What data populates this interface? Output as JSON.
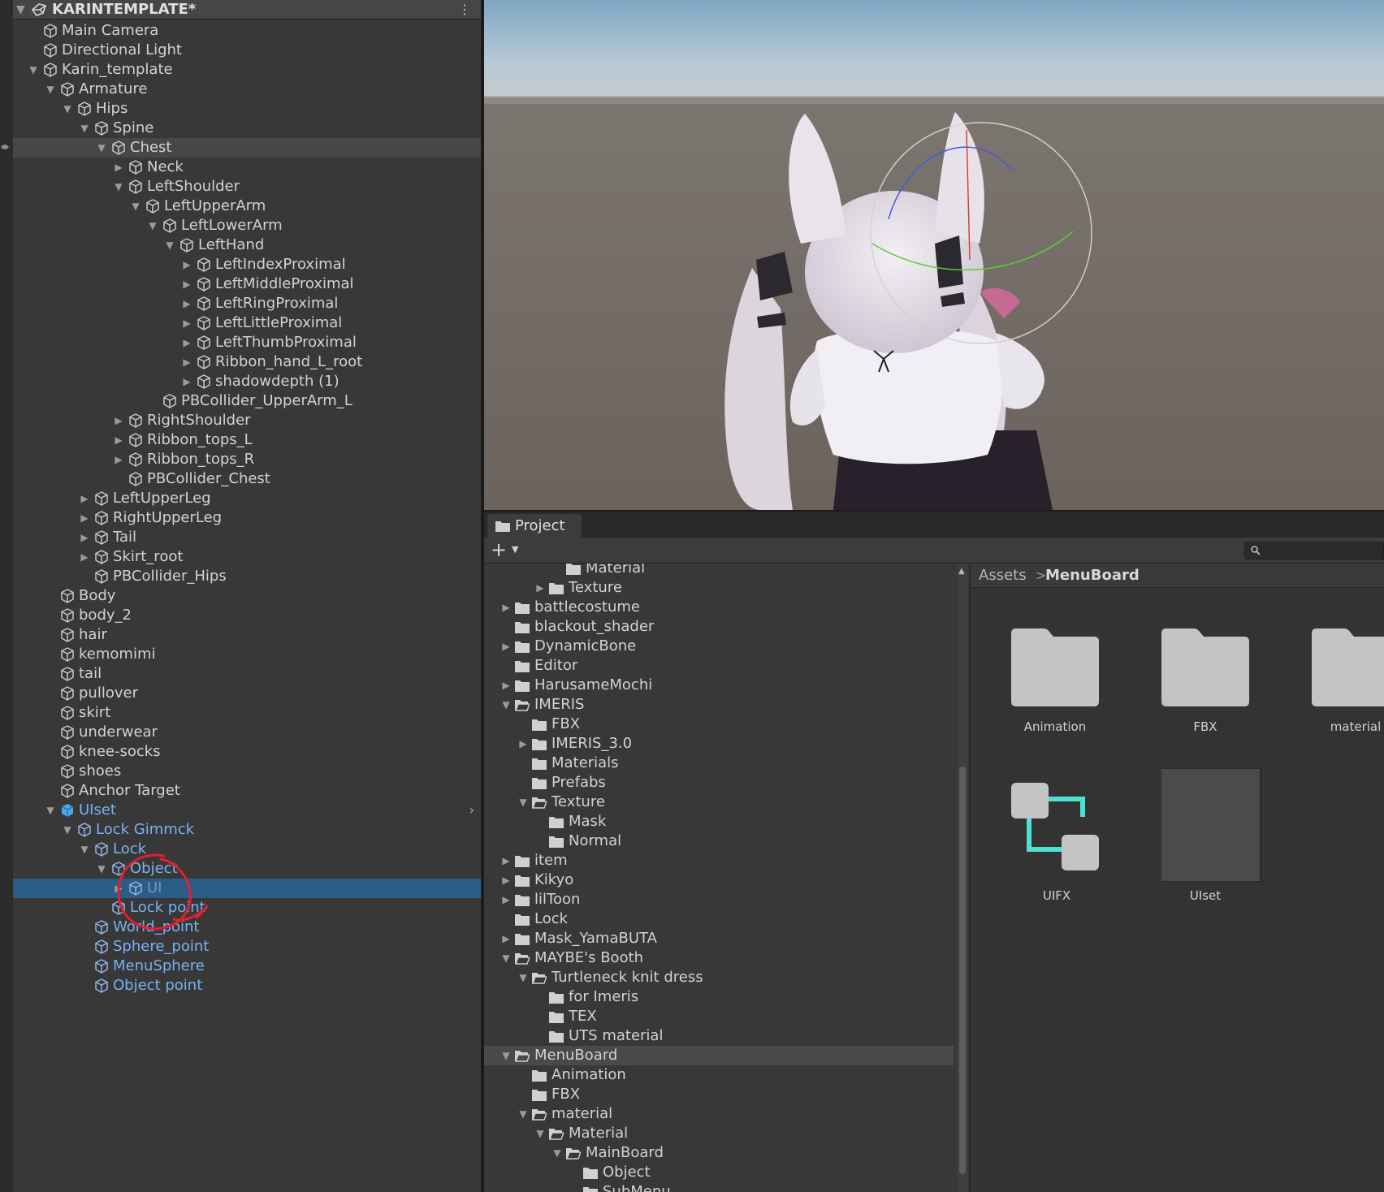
{
  "hierarchy": {
    "scene_title": "KARINTEMPLATE*",
    "rows": [
      {
        "label": "Main Camera",
        "depth": 2,
        "arrow": "",
        "icon": "cube-icon",
        "state": ""
      },
      {
        "label": "Directional Light",
        "depth": 2,
        "arrow": "",
        "icon": "cube-icon",
        "state": ""
      },
      {
        "label": "Karin_template",
        "depth": 2,
        "arrow": "down",
        "icon": "cube-icon",
        "state": ""
      },
      {
        "label": "Armature",
        "depth": 3,
        "arrow": "down",
        "icon": "cube-icon",
        "state": ""
      },
      {
        "label": "Hips",
        "depth": 4,
        "arrow": "down",
        "icon": "cube-icon",
        "state": ""
      },
      {
        "label": "Spine",
        "depth": 5,
        "arrow": "down",
        "icon": "cube-icon",
        "state": ""
      },
      {
        "label": "Chest",
        "depth": 6,
        "arrow": "down",
        "icon": "cube-icon",
        "state": "hover"
      },
      {
        "label": "Neck",
        "depth": 7,
        "arrow": "right",
        "icon": "cube-icon",
        "state": ""
      },
      {
        "label": "LeftShoulder",
        "depth": 7,
        "arrow": "down",
        "icon": "cube-icon",
        "state": ""
      },
      {
        "label": "LeftUpperArm",
        "depth": 8,
        "arrow": "down",
        "icon": "cube-icon",
        "state": ""
      },
      {
        "label": "LeftLowerArm",
        "depth": 9,
        "arrow": "down",
        "icon": "cube-icon",
        "state": ""
      },
      {
        "label": "LeftHand",
        "depth": 10,
        "arrow": "down",
        "icon": "cube-icon",
        "state": ""
      },
      {
        "label": "LeftIndexProximal",
        "depth": 11,
        "arrow": "right",
        "icon": "cube-icon",
        "state": ""
      },
      {
        "label": "LeftMiddleProximal",
        "depth": 11,
        "arrow": "right",
        "icon": "cube-icon",
        "state": ""
      },
      {
        "label": "LeftRingProximal",
        "depth": 11,
        "arrow": "right",
        "icon": "cube-icon",
        "state": ""
      },
      {
        "label": "LeftLittleProximal",
        "depth": 11,
        "arrow": "right",
        "icon": "cube-icon",
        "state": ""
      },
      {
        "label": "LeftThumbProximal",
        "depth": 11,
        "arrow": "right",
        "icon": "cube-icon",
        "state": ""
      },
      {
        "label": "Ribbon_hand_L_root",
        "depth": 11,
        "arrow": "right",
        "icon": "cube-icon",
        "state": ""
      },
      {
        "label": "shadowdepth (1)",
        "depth": 11,
        "arrow": "right",
        "icon": "cube-icon",
        "state": ""
      },
      {
        "label": "PBCollider_UpperArm_L",
        "depth": 9,
        "arrow": "",
        "icon": "cube-icon",
        "state": ""
      },
      {
        "label": "RightShoulder",
        "depth": 7,
        "arrow": "right",
        "icon": "cube-icon",
        "state": ""
      },
      {
        "label": "Ribbon_tops_L",
        "depth": 7,
        "arrow": "right",
        "icon": "cube-icon",
        "state": ""
      },
      {
        "label": "Ribbon_tops_R",
        "depth": 7,
        "arrow": "right",
        "icon": "cube-icon",
        "state": ""
      },
      {
        "label": "PBCollider_Chest",
        "depth": 7,
        "arrow": "",
        "icon": "cube-icon",
        "state": ""
      },
      {
        "label": "LeftUpperLeg",
        "depth": 5,
        "arrow": "right",
        "icon": "cube-icon",
        "state": ""
      },
      {
        "label": "RightUpperLeg",
        "depth": 5,
        "arrow": "right",
        "icon": "cube-icon",
        "state": ""
      },
      {
        "label": "Tail",
        "depth": 5,
        "arrow": "right",
        "icon": "cube-icon",
        "state": ""
      },
      {
        "label": "Skirt_root",
        "depth": 5,
        "arrow": "right",
        "icon": "cube-icon",
        "state": ""
      },
      {
        "label": "PBCollider_Hips",
        "depth": 5,
        "arrow": "",
        "icon": "cube-icon",
        "state": ""
      },
      {
        "label": "Body",
        "depth": 3,
        "arrow": "",
        "icon": "cube-icon",
        "state": ""
      },
      {
        "label": "body_2",
        "depth": 3,
        "arrow": "",
        "icon": "cube-icon",
        "state": ""
      },
      {
        "label": "hair",
        "depth": 3,
        "arrow": "",
        "icon": "cube-icon",
        "state": ""
      },
      {
        "label": "kemomimi",
        "depth": 3,
        "arrow": "",
        "icon": "cube-icon",
        "state": ""
      },
      {
        "label": "tail",
        "depth": 3,
        "arrow": "",
        "icon": "cube-icon",
        "state": ""
      },
      {
        "label": "pullover",
        "depth": 3,
        "arrow": "",
        "icon": "cube-icon",
        "state": ""
      },
      {
        "label": "skirt",
        "depth": 3,
        "arrow": "",
        "icon": "cube-icon",
        "state": ""
      },
      {
        "label": "underwear",
        "depth": 3,
        "arrow": "",
        "icon": "cube-icon",
        "state": ""
      },
      {
        "label": "knee-socks",
        "depth": 3,
        "arrow": "",
        "icon": "cube-icon",
        "state": ""
      },
      {
        "label": "shoes",
        "depth": 3,
        "arrow": "",
        "icon": "cube-icon",
        "state": ""
      },
      {
        "label": "Anchor Target",
        "depth": 3,
        "arrow": "",
        "icon": "cube-icon",
        "state": ""
      },
      {
        "label": "UIset",
        "depth": 3,
        "arrow": "down",
        "icon": "prefab-icon",
        "state": "blue",
        "chevron": true
      },
      {
        "label": "Lock Gimmck",
        "depth": 4,
        "arrow": "down",
        "icon": "cube-icon",
        "state": "blue"
      },
      {
        "label": "Lock",
        "depth": 5,
        "arrow": "down",
        "icon": "cube-icon",
        "state": "blue"
      },
      {
        "label": "Object",
        "depth": 6,
        "arrow": "down",
        "icon": "cube-icon",
        "state": "blue"
      },
      {
        "label": "UI",
        "depth": 7,
        "arrow": "right",
        "icon": "cube-icon",
        "state": "selected"
      },
      {
        "label": "Lock point",
        "depth": 6,
        "arrow": "",
        "icon": "cube-icon",
        "state": "blue"
      },
      {
        "label": "World_point",
        "depth": 5,
        "arrow": "",
        "icon": "cube-icon",
        "state": "blue"
      },
      {
        "label": "Sphere_point",
        "depth": 5,
        "arrow": "",
        "icon": "cube-icon",
        "state": "blue"
      },
      {
        "label": "MenuSphere",
        "depth": 5,
        "arrow": "",
        "icon": "cube-icon",
        "state": "blue"
      },
      {
        "label": "Object point",
        "depth": 5,
        "arrow": "",
        "icon": "cube-icon",
        "state": "blue"
      }
    ]
  },
  "project": {
    "tab_label": "Project",
    "add_label": "+",
    "search_placeholder": "",
    "tree": [
      {
        "label": "Material",
        "depth": 4,
        "arrow": "",
        "open": false,
        "state": ""
      },
      {
        "label": "Texture",
        "depth": 3,
        "arrow": "right",
        "open": false,
        "state": ""
      },
      {
        "label": "battlecostume",
        "depth": 1,
        "arrow": "right",
        "open": false,
        "state": ""
      },
      {
        "label": "blackout_shader",
        "depth": 1,
        "arrow": "",
        "open": false,
        "state": ""
      },
      {
        "label": "DynamicBone",
        "depth": 1,
        "arrow": "right",
        "open": false,
        "state": ""
      },
      {
        "label": "Editor",
        "depth": 1,
        "arrow": "",
        "open": false,
        "state": ""
      },
      {
        "label": "HarusameMochi",
        "depth": 1,
        "arrow": "right",
        "open": false,
        "state": ""
      },
      {
        "label": "IMERIS",
        "depth": 1,
        "arrow": "down",
        "open": true,
        "state": ""
      },
      {
        "label": "FBX",
        "depth": 2,
        "arrow": "",
        "open": false,
        "state": ""
      },
      {
        "label": "IMERIS_3.0",
        "depth": 2,
        "arrow": "right",
        "open": false,
        "state": ""
      },
      {
        "label": "Materials",
        "depth": 2,
        "arrow": "",
        "open": false,
        "state": ""
      },
      {
        "label": "Prefabs",
        "depth": 2,
        "arrow": "",
        "open": false,
        "state": ""
      },
      {
        "label": "Texture",
        "depth": 2,
        "arrow": "down",
        "open": true,
        "state": ""
      },
      {
        "label": "Mask",
        "depth": 3,
        "arrow": "",
        "open": false,
        "state": ""
      },
      {
        "label": "Normal",
        "depth": 3,
        "arrow": "",
        "open": false,
        "state": ""
      },
      {
        "label": "item",
        "depth": 1,
        "arrow": "right",
        "open": false,
        "state": ""
      },
      {
        "label": "Kikyo",
        "depth": 1,
        "arrow": "right",
        "open": false,
        "state": ""
      },
      {
        "label": "lilToon",
        "depth": 1,
        "arrow": "right",
        "open": false,
        "state": ""
      },
      {
        "label": "Lock",
        "depth": 1,
        "arrow": "",
        "open": false,
        "state": ""
      },
      {
        "label": "Mask_YamaBUTA",
        "depth": 1,
        "arrow": "right",
        "open": false,
        "state": ""
      },
      {
        "label": "MAYBE's Booth",
        "depth": 1,
        "arrow": "down",
        "open": true,
        "state": ""
      },
      {
        "label": "Turtleneck knit dress",
        "depth": 2,
        "arrow": "down",
        "open": true,
        "state": ""
      },
      {
        "label": "for Imeris",
        "depth": 3,
        "arrow": "",
        "open": false,
        "state": ""
      },
      {
        "label": "TEX",
        "depth": 3,
        "arrow": "",
        "open": false,
        "state": ""
      },
      {
        "label": "UTS material",
        "depth": 3,
        "arrow": "",
        "open": false,
        "state": ""
      },
      {
        "label": "MenuBoard",
        "depth": 1,
        "arrow": "down",
        "open": true,
        "state": "hover"
      },
      {
        "label": "Animation",
        "depth": 2,
        "arrow": "",
        "open": false,
        "state": ""
      },
      {
        "label": "FBX",
        "depth": 2,
        "arrow": "",
        "open": false,
        "state": ""
      },
      {
        "label": "material",
        "depth": 2,
        "arrow": "down",
        "open": true,
        "state": ""
      },
      {
        "label": "Material",
        "depth": 3,
        "arrow": "down",
        "open": true,
        "state": ""
      },
      {
        "label": "MainBoard",
        "depth": 4,
        "arrow": "down",
        "open": true,
        "state": ""
      },
      {
        "label": "Object",
        "depth": 5,
        "arrow": "",
        "open": false,
        "state": ""
      },
      {
        "label": "SubMenu",
        "depth": 5,
        "arrow": "",
        "open": false,
        "state": ""
      }
    ],
    "breadcrumb": {
      "root": "Assets",
      "separator": ">",
      "current": "MenuBoard"
    },
    "assets": [
      {
        "label": "Animation",
        "kind": "folder"
      },
      {
        "label": "FBX",
        "kind": "folder"
      },
      {
        "label": "material",
        "kind": "folder"
      },
      {
        "label": "UIFX",
        "kind": "uifx"
      },
      {
        "label": "UIset",
        "kind": "prefab"
      }
    ]
  },
  "colors": {
    "selected_row": "#2c5d87",
    "prefab_text": "#7ab0f5",
    "annotation_red": "#e0212e"
  }
}
